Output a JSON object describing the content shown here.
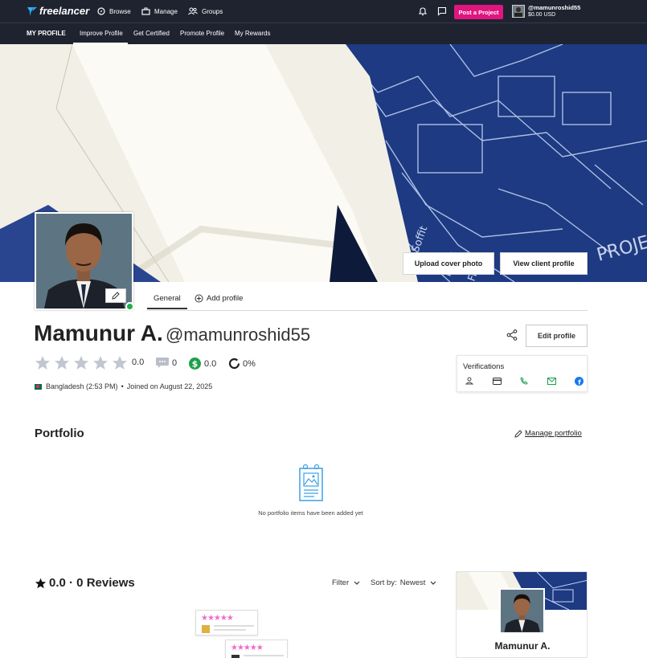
{
  "topbar": {
    "logo": "freelancer",
    "browse": "Browse",
    "manage": "Manage",
    "groups": "Groups",
    "post_project": "Post a Project",
    "username": "@mamunroshid55",
    "balance": "$0.00 USD"
  },
  "subnav": {
    "items": [
      "MY PROFILE",
      "Improve Profile",
      "Get Certified",
      "Promote Profile",
      "My Rewards"
    ]
  },
  "cover": {
    "upload_cover": "Upload cover photo",
    "view_client": "View client profile"
  },
  "tabs": {
    "general": "General",
    "add_profile": "Add profile"
  },
  "profile": {
    "name": "Mamunur A.",
    "handle": "@mamunroshid55",
    "edit_profile": "Edit profile",
    "rating": "0.0",
    "rating_fraction": 0,
    "reviews_count": "0",
    "earnings": "0.0",
    "completion": "0%",
    "location": "Bangladesh (2:53 PM)",
    "joined": "Joined on August 22, 2025"
  },
  "verifications": {
    "title": "Verifications",
    "icons": [
      "identity-icon",
      "payment-icon",
      "phone-icon",
      "email-icon",
      "facebook-icon"
    ]
  },
  "portfolio": {
    "title": "Portfolio",
    "manage": "Manage portfolio",
    "empty": "No portfolio items have been added yet"
  },
  "reviews": {
    "title": "0.0 · 0 Reviews",
    "filter": "Filter",
    "sort_label": "Sort by:",
    "sort_value": "Newest"
  },
  "mini_card": {
    "name": "Mamunur A."
  },
  "colors": {
    "nav_bg": "#1f2330",
    "brand_pink": "#e0157f",
    "online_green": "#1fae48",
    "earnings_green": "#1f9e4a"
  }
}
